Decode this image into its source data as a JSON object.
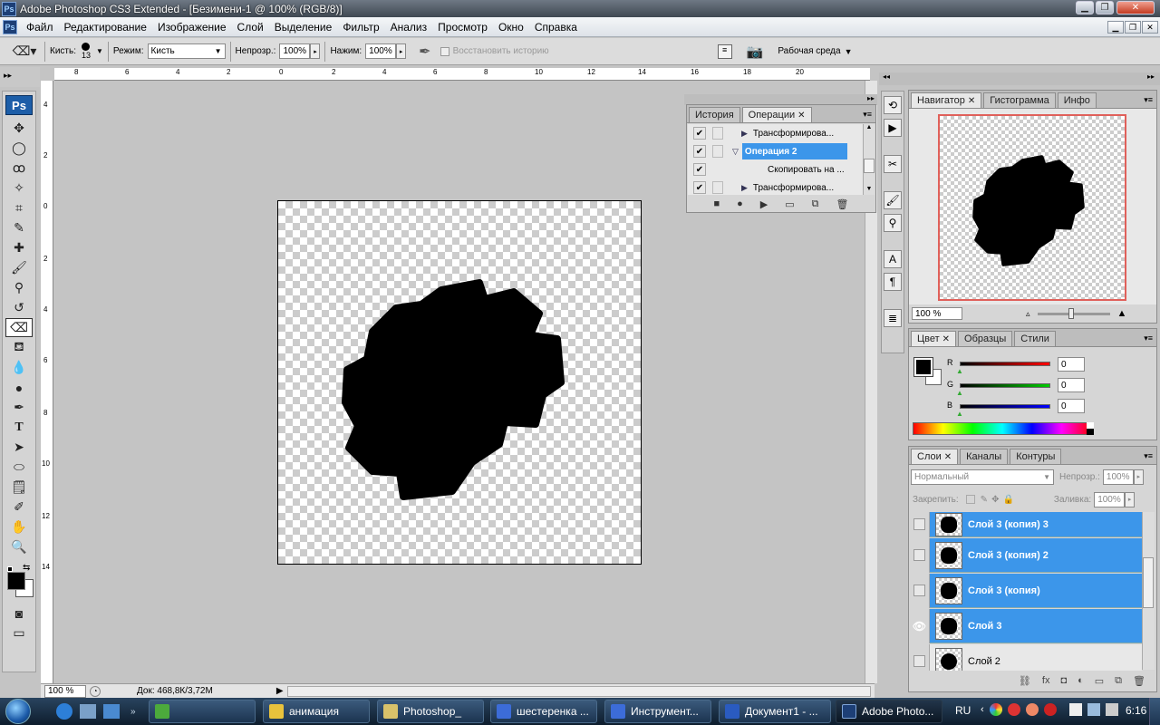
{
  "window": {
    "title": "Adobe Photoshop CS3 Extended - [Безимени-1 @ 100% (RGB/8)]",
    "ps_badge": "Ps"
  },
  "menu": [
    "Файл",
    "Редактирование",
    "Изображение",
    "Слой",
    "Выделение",
    "Фильтр",
    "Анализ",
    "Просмотр",
    "Окно",
    "Справка"
  ],
  "options": {
    "brush_label": "Кисть:",
    "brush_size": "13",
    "mode_label": "Режим:",
    "mode_value": "Кисть",
    "opacity_label": "Непрозр.:",
    "opacity_value": "100%",
    "flow_label": "Нажим:",
    "flow_value": "100%",
    "restore_history": "Восстановить историю",
    "workspace": "Рабочая среда"
  },
  "rulers": {
    "top": [
      "8",
      "6",
      "4",
      "2",
      "0",
      "2",
      "4",
      "6",
      "8",
      "10",
      "12",
      "14",
      "16",
      "18",
      "20"
    ],
    "left": [
      "4",
      "2",
      "0",
      "2",
      "4",
      "6",
      "8",
      "10",
      "12",
      "14"
    ]
  },
  "status": {
    "zoom": "100 %",
    "doc": "Док: 468,8К/3,72М"
  },
  "actions_panel": {
    "tabs": [
      "История",
      "Операции"
    ],
    "rows": [
      {
        "label": "Трансформирова...",
        "checked": true,
        "indent": 2,
        "selected": false
      },
      {
        "label": "Операция 2",
        "checked": true,
        "indent": 1,
        "selected": true
      },
      {
        "label": "Скопировать на ...",
        "checked": true,
        "indent": 3,
        "selected": false
      },
      {
        "label": "Трансформирова...",
        "checked": true,
        "indent": 2,
        "selected": false
      }
    ]
  },
  "navigator": {
    "tabs": [
      "Навигатор",
      "Гистограмма",
      "Инфо"
    ],
    "zoom": "100 %"
  },
  "color": {
    "tabs": [
      "Цвет",
      "Образцы",
      "Стили"
    ],
    "r_label": "R",
    "g_label": "G",
    "b_label": "B",
    "r": "0",
    "g": "0",
    "b": "0"
  },
  "layers": {
    "tabs": [
      "Слои",
      "Каналы",
      "Контуры"
    ],
    "blend": "Нормальный",
    "opacity_label": "Непрозр.:",
    "opacity": "100%",
    "lock_label": "Закрепить:",
    "fill_label": "Заливка:",
    "fill": "100%",
    "items": [
      {
        "name": "Слой 3 (копия) 3",
        "selected": true,
        "visible": false
      },
      {
        "name": "Слой 3 (копия) 2",
        "selected": true,
        "visible": false
      },
      {
        "name": "Слой 3 (копия)",
        "selected": true,
        "visible": false
      },
      {
        "name": "Слой 3",
        "selected": true,
        "visible": true
      },
      {
        "name": "Слой 2",
        "selected": false,
        "visible": false
      }
    ]
  },
  "taskbar": {
    "buttons": [
      {
        "label": "анимация",
        "color": "#e8c23c"
      },
      {
        "label": "Photoshop_",
        "color": "#d9c26a"
      },
      {
        "label": "шестеренка ...",
        "color": "#3c6cd8"
      },
      {
        "label": "Инструмент...",
        "color": "#3c6cd8"
      },
      {
        "label": "Документ1 - ...",
        "color": "#2a5bc0"
      },
      {
        "label": "Adobe Photo...",
        "color": "#1d3f76"
      }
    ],
    "lang": "RU",
    "clock": "6:16"
  }
}
